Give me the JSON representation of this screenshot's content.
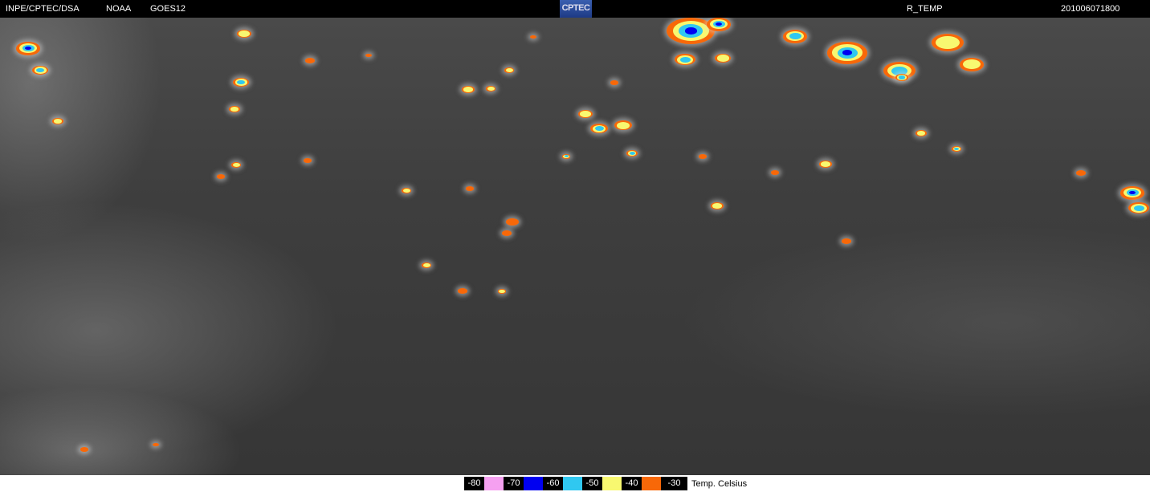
{
  "header": {
    "agency": "INPE/CPTEC/DSA",
    "source": "NOAA",
    "satellite": "GOES12",
    "logo_text": "CPTEC",
    "product": "R_TEMP",
    "timestamp": "201006071800"
  },
  "legend": {
    "title": "Temp. Celsius",
    "items": [
      {
        "label": "-80",
        "color": "#f5a0f0"
      },
      {
        "label": "-70",
        "color": "#0000f0"
      },
      {
        "label": "-60",
        "color": "#30c8f0"
      },
      {
        "label": "-50",
        "color": "#f8f870"
      },
      {
        "label": "-40",
        "color": "#f86808"
      },
      {
        "label": "-30",
        "color": null
      }
    ]
  }
}
